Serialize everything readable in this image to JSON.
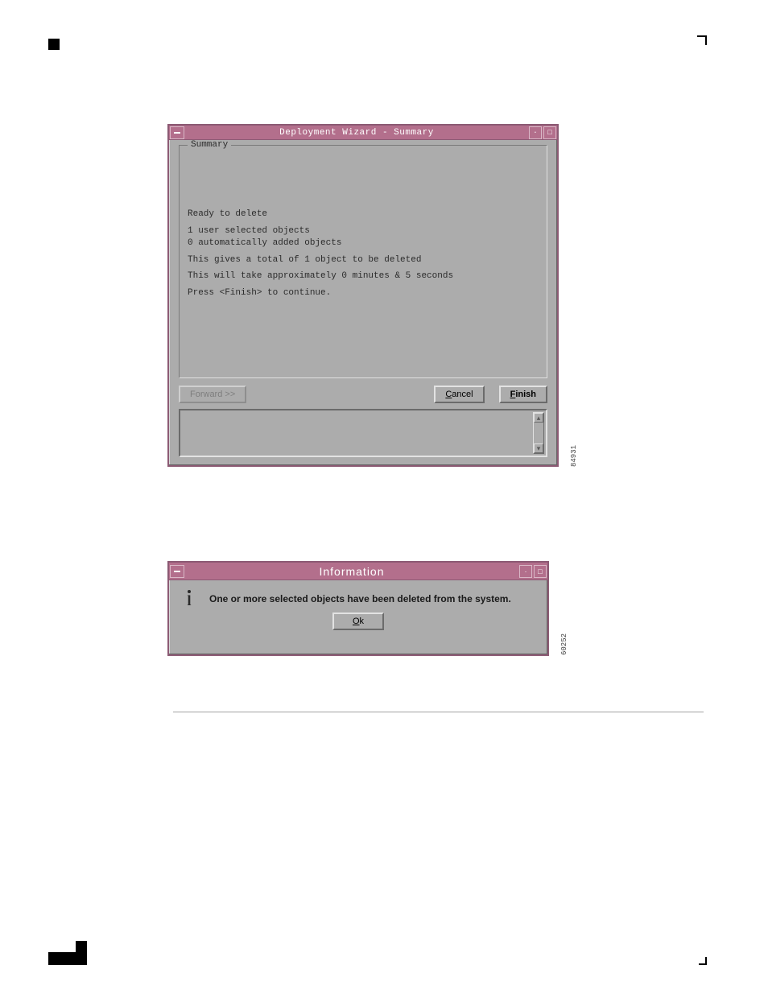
{
  "page": {
    "figure_ref_wizard": "84931",
    "figure_ref_info": "60252"
  },
  "wizard": {
    "title": "Deployment Wizard - Summary",
    "frame_legend": "Summary",
    "lines": {
      "ready": "Ready to delete",
      "user_sel": "1 user selected objects",
      "auto_add": "0 automatically added objects",
      "total": "This gives a total of 1 object to be deleted",
      "duration": "This will take approximately 0 minutes & 5 seconds",
      "press": "Press <Finish> to continue."
    },
    "buttons": {
      "forward": "Forward >>",
      "cancel_prefix": "C",
      "cancel_rest": "ancel",
      "finish_prefix": "F",
      "finish_rest": "inish"
    }
  },
  "info": {
    "title": "Information",
    "message": "One or more selected objects have been deleted from the system.",
    "ok_prefix": "O",
    "ok_rest": "k"
  }
}
